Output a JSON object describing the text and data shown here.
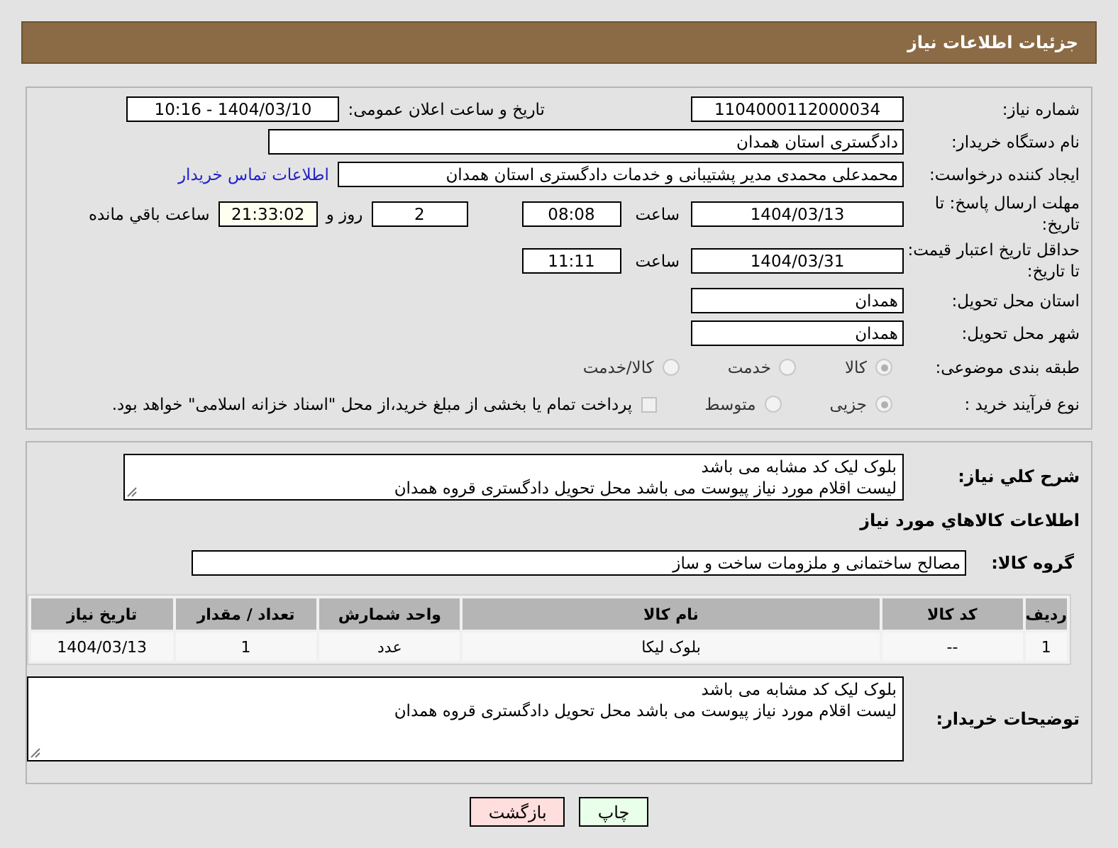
{
  "header": {
    "title": "جزئیات اطلاعات نیاز"
  },
  "need_number": {
    "label": "شماره نیاز:",
    "value": "1104000112000034"
  },
  "announce": {
    "label": "تاریخ و ساعت اعلان عمومی:",
    "value": "1404/03/10 - 10:16"
  },
  "buyer_org": {
    "label": "نام دستگاه خریدار:",
    "value": "دادگستری استان همدان"
  },
  "creator": {
    "label": "ایجاد کننده درخواست:",
    "value": "محمدعلی محمدی مدیر پشتیبانی و خدمات دادگستری استان همدان",
    "contact_link": "اطلاعات تماس خریدار"
  },
  "reply_deadline": {
    "label": "مهلت ارسال پاسخ: تا تاریخ:",
    "date": "1404/03/13",
    "time_label": "ساعت",
    "time": "08:08",
    "days": "2",
    "days_label": "روز و",
    "remaining": "21:33:02",
    "remaining_label": "ساعت باقي مانده"
  },
  "price_validity": {
    "label": "حداقل تاریخ اعتبار قیمت: تا تاریخ:",
    "date": "1404/03/31",
    "time_label": "ساعت",
    "time": "11:11"
  },
  "delivery_province": {
    "label": "استان محل تحویل:",
    "value": "همدان"
  },
  "delivery_city": {
    "label": "شهر محل تحویل:",
    "value": "همدان"
  },
  "category": {
    "label": "طبقه بندی موضوعی:",
    "options": [
      {
        "label": "کالا",
        "selected": true
      },
      {
        "label": "خدمت",
        "selected": false
      },
      {
        "label": "کالا/خدمت",
        "selected": false
      }
    ]
  },
  "process": {
    "label": "نوع فرآیند خرید :",
    "options": [
      {
        "label": "جزیی",
        "selected": true
      },
      {
        "label": "متوسط",
        "selected": false
      }
    ],
    "payment": {
      "label": "پرداخت تمام یا بخشی از مبلغ خرید،از محل \"اسناد خزانه اسلامی\" خواهد بود.",
      "checked": false
    }
  },
  "description": {
    "label": "شرح كلي نياز:",
    "lines": [
      "بلوک لیک کد مشابه می باشد",
      "لیست اقلام مورد نیاز پیوست می باشد محل تحویل دادگستری قروه همدان"
    ]
  },
  "goods_heading": "اطلاعات كالاهاي مورد نياز",
  "goods_group": {
    "label": "گروه کالا:",
    "value": "مصالح ساختمانی و ملزومات ساخت و ساز"
  },
  "table": {
    "columns": [
      "رديف",
      "كد كالا",
      "نام كالا",
      "واحد شمارش",
      "تعداد / مقدار",
      "تاريخ نياز"
    ],
    "rows": [
      [
        "1",
        "--",
        "بلوک لیکا",
        "عدد",
        "1",
        "1404/03/13"
      ]
    ]
  },
  "buyer_notes": {
    "label": "توضیحات خریدار:",
    "lines": [
      "بلوک لیک کد مشابه می باشد",
      "لیست اقلام مورد نیاز پیوست می باشد محل تحویل دادگستری قروه همدان"
    ]
  },
  "buttons": [
    {
      "kind": "print",
      "label": "چاپ"
    },
    {
      "kind": "back",
      "label": "بازگشت"
    }
  ]
}
